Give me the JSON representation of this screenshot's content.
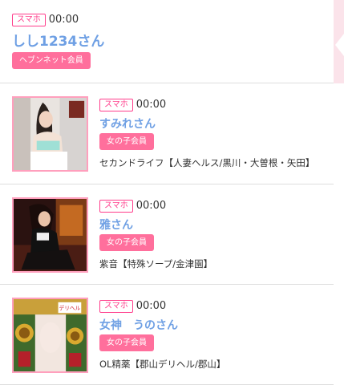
{
  "top_entry": {
    "device": "スマホ",
    "time": "00:00",
    "name": "しし1234さん",
    "badge": "ヘブンネット会員"
  },
  "entries": [
    {
      "device": "スマホ",
      "time": "00:00",
      "name": "すみれさん",
      "badge": "女の子会員",
      "shop": "セカンドライフ【人妻ヘルス/黒川・大曽根・矢田】"
    },
    {
      "device": "スマホ",
      "time": "00:00",
      "name": "雅さん",
      "badge": "女の子会員",
      "shop": "紫音【特殊ソープ/金津園】"
    },
    {
      "device": "スマホ",
      "time": "00:00",
      "name": "女神　うのさん",
      "badge": "女の子会員",
      "shop": "OL精薬【郡山デリヘル/郡山】",
      "thumb_text": "デリヘル"
    }
  ],
  "colors": {
    "device_border": "#ff3d8b",
    "name": "#6fa0e4",
    "badge_bg": "#ff6f9c",
    "thumb_border": "#ff9fbd"
  }
}
